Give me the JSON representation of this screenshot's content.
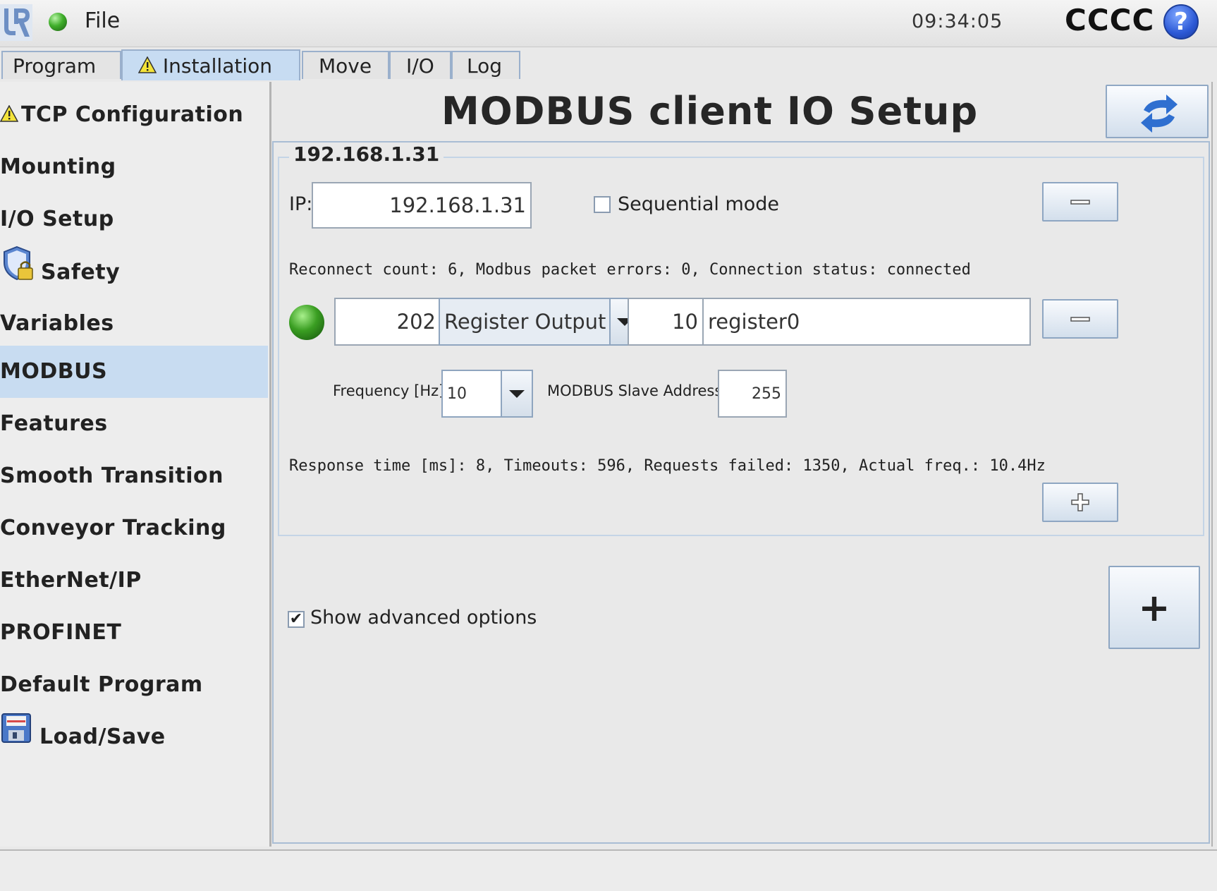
{
  "topbar": {
    "file_label": "File",
    "clock": "09:34:05",
    "robot_name": "CCCC",
    "help_label": "?"
  },
  "tabs": [
    {
      "label": "Program",
      "active": false
    },
    {
      "label": "Installation",
      "active": true,
      "warning": true
    },
    {
      "label": "Move",
      "active": false
    },
    {
      "label": "I/O",
      "active": false
    },
    {
      "label": "Log",
      "active": false
    }
  ],
  "sidebar": {
    "items": [
      {
        "label": "TCP Configuration",
        "icon": "warning-icon"
      },
      {
        "label": "Mounting"
      },
      {
        "label": "I/O Setup"
      },
      {
        "label": "Safety",
        "icon": "safety-shield-icon"
      },
      {
        "label": "Variables"
      },
      {
        "label": "MODBUS",
        "active": true
      },
      {
        "label": "Features"
      },
      {
        "label": "Smooth Transition"
      },
      {
        "label": "Conveyor Tracking"
      },
      {
        "label": "EtherNet/IP"
      },
      {
        "label": "PROFINET"
      },
      {
        "label": "Default Program"
      },
      {
        "label": "Load/Save",
        "icon": "floppy-disk-icon"
      }
    ]
  },
  "main": {
    "title": "MODBUS client IO Setup",
    "unit": {
      "legend": "192.168.1.31",
      "ip_label": "IP:",
      "ip_value": "192.168.1.31",
      "sequential_label": "Sequential mode",
      "sequential_checked": false,
      "status_text": "Reconnect count: 6, Modbus packet errors: 0, Connection status: connected",
      "signal": {
        "address": "202",
        "type": "Register Output",
        "value": "10",
        "name": "register0",
        "frequency_label": "Frequency [Hz]",
        "frequency_value": "10",
        "slave_label": "MODBUS Slave Address",
        "slave_value": "255",
        "response_text": "Response time [ms]: 8, Timeouts: 596, Requests failed: 1350, Actual freq.: 10.4Hz"
      }
    },
    "advanced_label": "Show advanced options",
    "advanced_checked": true,
    "add_unit_label": "+"
  },
  "colors": {
    "accent": "#c8dcf1",
    "status_green": "#3a9e22",
    "help_blue": "#2c59d6"
  }
}
